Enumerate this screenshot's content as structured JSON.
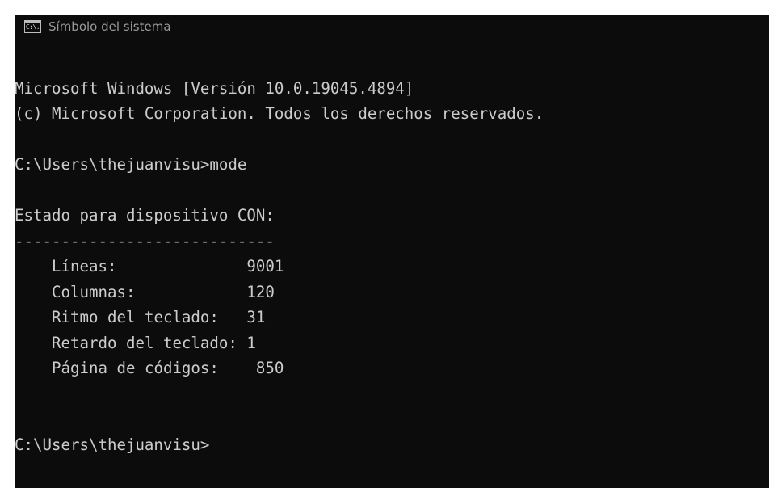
{
  "window": {
    "title": "Símbolo del sistema",
    "icon": "cmd-icon",
    "icon_text": "C:\\."
  },
  "console": {
    "banner_line1": "Microsoft Windows [Versión 10.0.19045.4894]",
    "banner_line2": "(c) Microsoft Corporation. Todos los derechos reservados.",
    "command_prompt": "C:\\Users\\thejuanvisu>",
    "command": "mode",
    "device_heading": "Estado para dispositivo CON:",
    "separator": "----------------------------",
    "status_rows": [
      {
        "label": "Líneas:",
        "value": "9001",
        "pad": "              "
      },
      {
        "label": "Columnas:",
        "value": "120",
        "pad": "            "
      },
      {
        "label": "Ritmo del teclado:",
        "value": "31",
        "pad": "   "
      },
      {
        "label": "Retardo del teclado:",
        "value": "1",
        "pad": " "
      },
      {
        "label": "Página de códigos:",
        "value": "850",
        "pad": "    "
      }
    ],
    "final_prompt": "C:\\Users\\thejuanvisu>"
  },
  "colors": {
    "background": "#0c0c0c",
    "text": "#cccccc",
    "title_text": "#9a9a9a"
  }
}
